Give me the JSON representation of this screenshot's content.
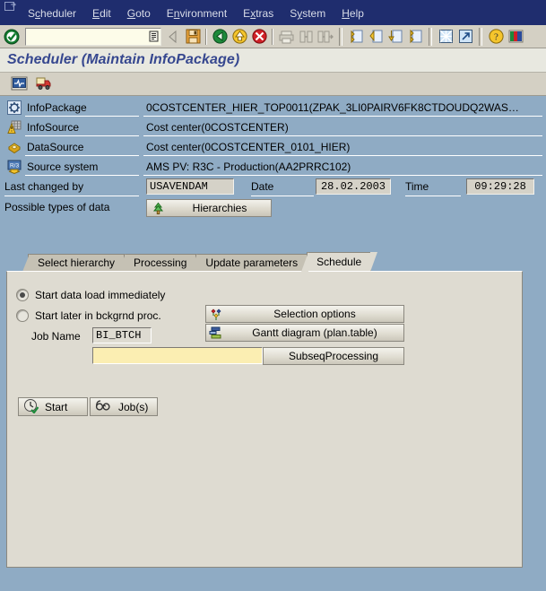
{
  "menu": {
    "items": [
      {
        "pre": "S",
        "acc": "c",
        "post": "heduler"
      },
      {
        "pre": "",
        "acc": "E",
        "post": "dit"
      },
      {
        "pre": "",
        "acc": "G",
        "post": "oto"
      },
      {
        "pre": "E",
        "acc": "n",
        "post": "vironment"
      },
      {
        "pre": "E",
        "acc": "x",
        "post": "tras"
      },
      {
        "pre": "S",
        "acc": "y",
        "post": "stem"
      },
      {
        "pre": "",
        "acc": "H",
        "post": "elp"
      }
    ]
  },
  "toolbar": {
    "command_value": "",
    "command_placeholder": "",
    "icons": [
      "enter-check-icon",
      "back-arrow-icon",
      "save-icon",
      "exit-green-icon",
      "back-yellow-icon",
      "cancel-red-icon",
      "print-icon",
      "find-icon",
      "find-next-icon",
      "first-page-icon",
      "previous-page-icon",
      "next-page-icon",
      "last-page-icon",
      "new-session-icon",
      "create-shortcut-icon",
      "help-icon",
      "customize-layout-icon"
    ]
  },
  "title": "Scheduler (Maintain InfoPackage)",
  "app_toolbar": {
    "buttons": [
      "monitor-icon",
      "delivery-truck-icon"
    ]
  },
  "info": {
    "rows": [
      {
        "icon": "infopackage-gear-icon",
        "label": "InfoPackage",
        "value": "0COSTCENTER_HIER_TOP0011(ZPAK_3LI0PAIRV6FK8CTDOUDQ2WAS…"
      },
      {
        "icon": "infosource-grid-icon",
        "label": "InfoSource",
        "value": "Cost center(0COSTCENTER)"
      },
      {
        "icon": "datasource-cube-icon",
        "label": "DataSource",
        "value": "Cost center(0COSTCENTER_0101_HIER)"
      },
      {
        "icon": "source-system-r3-icon",
        "label": "Source system",
        "value": "AMS PV: R3C - Production(AA2PRRC102)"
      }
    ],
    "last_changed_by_label": "Last changed by",
    "last_changed_by_value": "USAVENDAM",
    "date_label": "Date",
    "date_value": "28.02.2003",
    "time_label": "Time",
    "time_value": "09:29:28",
    "possible_types_label": "Possible types of data",
    "hierarchies_button": "Hierarchies"
  },
  "tabs": [
    {
      "label": "Select hierarchy",
      "active": false
    },
    {
      "label": "Processing",
      "active": false
    },
    {
      "label": "Update parameters",
      "active": false
    },
    {
      "label": "Schedule",
      "active": true
    }
  ],
  "schedule": {
    "start_immediately_label": "Start data load immediately",
    "start_immediately_selected": true,
    "start_later_label": "Start later in bckgrnd proc.",
    "start_later_selected": false,
    "job_name_label": "Job Name",
    "job_name_value": "BI_BTCH",
    "second_input_value": "",
    "selection_options_button": "Selection options",
    "gantt_button": "Gantt diagram (plan.table)",
    "subseq_button": "SubseqProcessing",
    "start_button": "Start",
    "jobs_button": "Job(s)"
  },
  "colors": {
    "desktop": "#8fabc4",
    "menubar": "#1f2d6e",
    "toolbar": "#d4d0c4",
    "title_text": "#36478f",
    "panel": "#dedbd1",
    "input_yellow": "#fbeeb2",
    "command_field": "#fdfce9"
  }
}
